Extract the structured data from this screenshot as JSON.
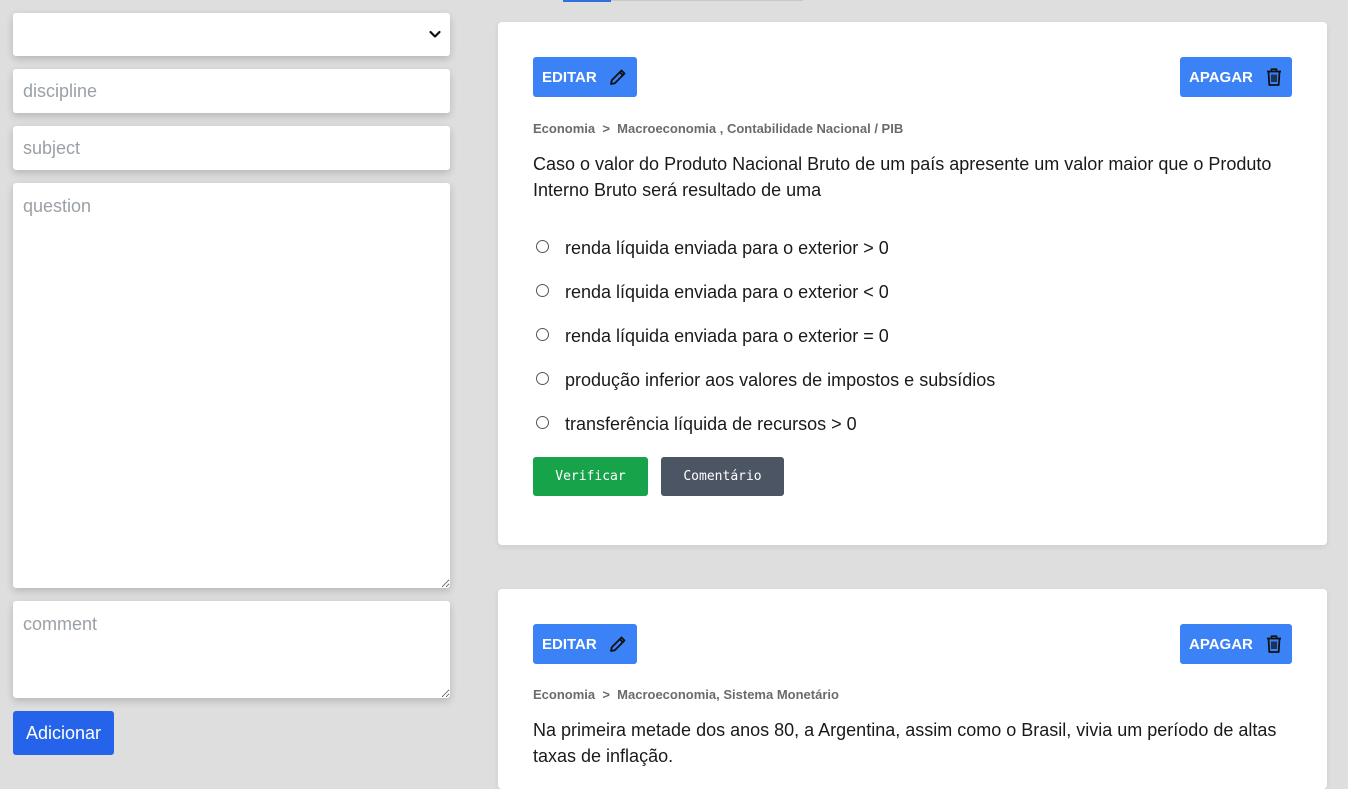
{
  "form": {
    "select_value": "",
    "discipline_placeholder": "discipline",
    "subject_placeholder": "subject",
    "question_placeholder": "question",
    "comment_placeholder": "comment",
    "add_label": "Adicionar"
  },
  "cards": [
    {
      "edit_label": "EDITAR",
      "delete_label": "APAGAR",
      "breadcrumb": "Economia  >  Macroeconomia , Contabilidade Nacional / PIB",
      "question": "Caso o valor do Produto Nacional Bruto de um país apresente um valor maior que o Produto Interno Bruto será resultado de uma",
      "options": [
        "renda líquida enviada para o exterior > 0",
        "renda líquida enviada para o exterior < 0",
        "renda líquida enviada para o exterior = 0",
        "produção inferior aos valores de impostos e subsídios",
        "transferência líquida de recursos > 0"
      ],
      "check_label": "Verificar",
      "comment_label": "Comentário"
    },
    {
      "edit_label": "EDITAR",
      "delete_label": "APAGAR",
      "breadcrumb": "Economia  >  Macroeconomia, Sistema Monetário",
      "question": "Na primeira metade dos anos 80, a Argentina, assim como o Brasil, vivia um período de altas taxas de inflação."
    }
  ],
  "colors": {
    "background": "#dedede",
    "action_blue": "#3b82f6",
    "add_blue": "#2563eb",
    "check_green": "#16a34a",
    "comment_gray": "#4b5563"
  },
  "icons": {
    "edit": "pencil-icon",
    "delete": "trash-icon",
    "select": "chevron-down-icon"
  }
}
